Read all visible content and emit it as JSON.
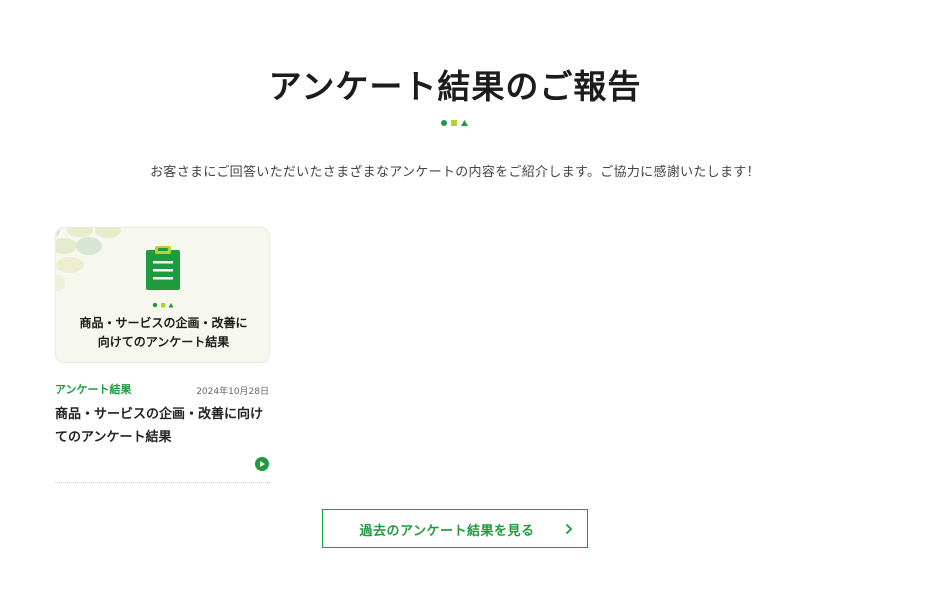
{
  "section": {
    "title": "アンケート結果のご報告",
    "intro": "お客さまにご回答いただいたさまざまなアンケートの内容をご紹介します。ご協力に感謝いたします！"
  },
  "card": {
    "thumbnail_title_line1": "商品・サービスの企画・改善に",
    "thumbnail_title_line2": "向けてのアンケート結果",
    "category": "アンケート結果",
    "date": "2024年10月28日",
    "title": "商品・サービスの企画・改善に向けてのアンケート結果"
  },
  "more_button": {
    "label": "過去のアンケート結果を見る"
  },
  "colors": {
    "accent_green": "#1f9a3e",
    "mark_lime": "#b6d334",
    "thumbnail_background": "#f6f7ee"
  },
  "icons": {
    "title_marks": "circle-square-triangle-marks",
    "thumbnail": "clipboard-icon",
    "card_arrow": "arrow-circle-icon",
    "button_arrow": "chevron-right-icon"
  }
}
